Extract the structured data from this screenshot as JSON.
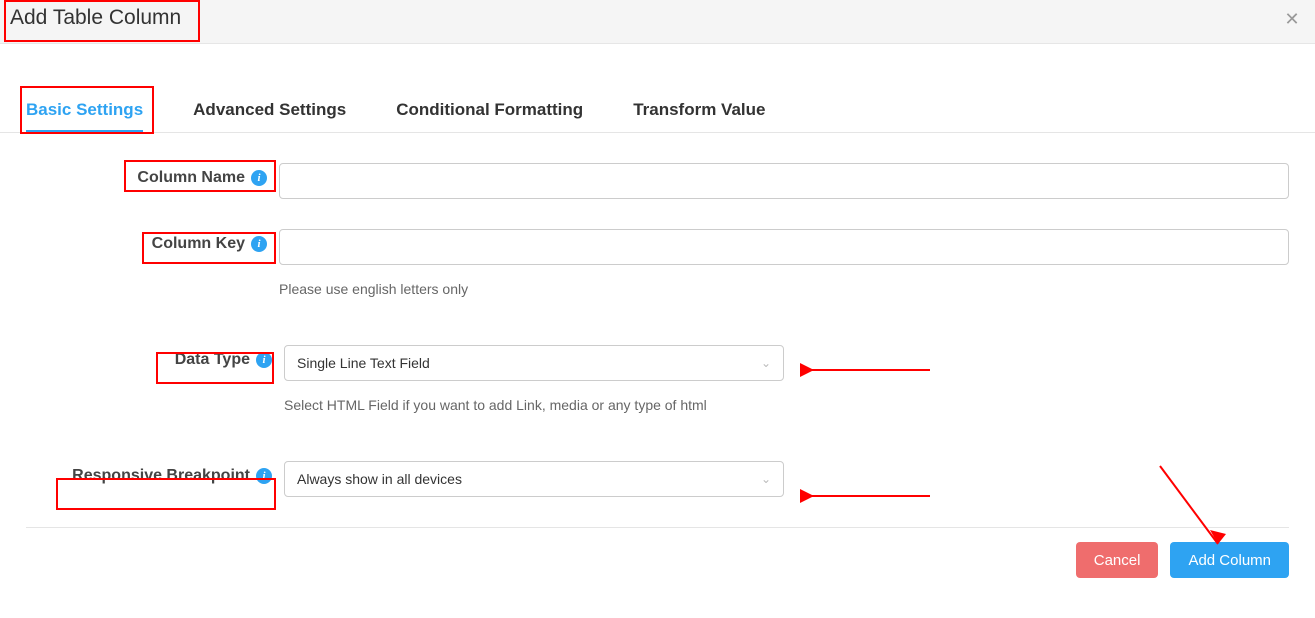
{
  "header": {
    "title": "Add Table Column"
  },
  "tabs": {
    "basic": "Basic Settings",
    "advanced": "Advanced Settings",
    "conditional": "Conditional Formatting",
    "transform": "Transform Value"
  },
  "fields": {
    "column_name": {
      "label": "Column Name",
      "value": ""
    },
    "column_key": {
      "label": "Column Key",
      "value": "",
      "helper": "Please use english letters only"
    },
    "data_type": {
      "label": "Data Type",
      "selected": "Single Line Text Field",
      "helper": "Select HTML Field if you want to add Link, media or any type of html"
    },
    "breakpoint": {
      "label": "Responsive Breakpoint",
      "selected": "Always show in all devices"
    }
  },
  "footer": {
    "cancel_label": "Cancel",
    "submit_label": "Add Column"
  }
}
